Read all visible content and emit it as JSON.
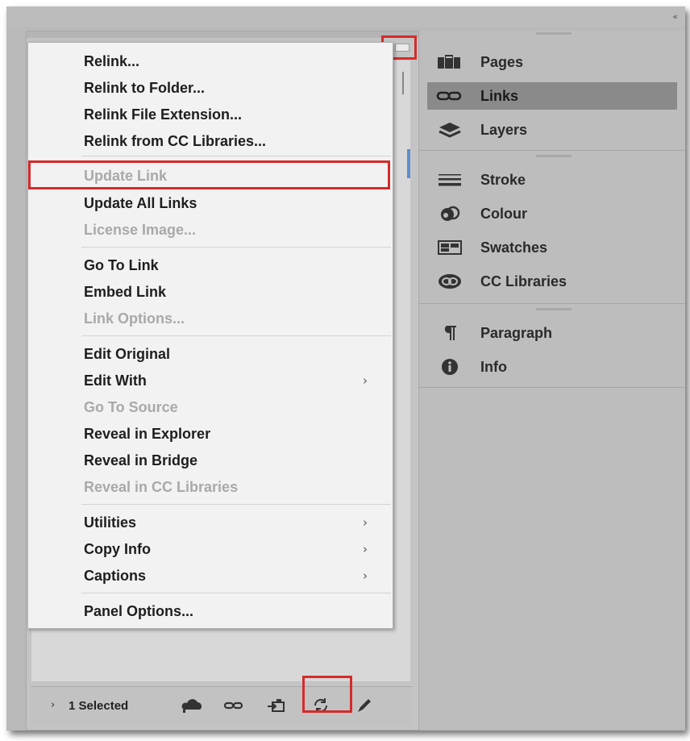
{
  "window": {
    "collapse_glyph": "«"
  },
  "links_panel": {
    "status_text": "1 Selected",
    "footer_icons": [
      "cc-libraries-icon",
      "relink-icon",
      "go-to-link-icon",
      "update-link-icon",
      "edit-original-icon"
    ]
  },
  "context_menu": {
    "items": [
      {
        "label": "Relink...",
        "enabled": true
      },
      {
        "label": "Relink to Folder...",
        "enabled": true
      },
      {
        "label": "Relink File Extension...",
        "enabled": true
      },
      {
        "label": "Relink from CC Libraries...",
        "enabled": true
      },
      {
        "label": "Update Link",
        "enabled": false
      },
      {
        "label": "Update All Links",
        "enabled": true
      },
      {
        "label": "License Image...",
        "enabled": false
      },
      {
        "label": "Go To Link",
        "enabled": true
      },
      {
        "label": "Embed Link",
        "enabled": true
      },
      {
        "label": "Link Options...",
        "enabled": false
      },
      {
        "label": "Edit Original",
        "enabled": true
      },
      {
        "label": "Edit With",
        "enabled": true,
        "submenu": true
      },
      {
        "label": "Go To Source",
        "enabled": false
      },
      {
        "label": "Reveal in Explorer",
        "enabled": true
      },
      {
        "label": "Reveal in Bridge",
        "enabled": true
      },
      {
        "label": "Reveal in CC Libraries",
        "enabled": false
      },
      {
        "label": "Utilities",
        "enabled": true,
        "submenu": true
      },
      {
        "label": "Copy Info",
        "enabled": true,
        "submenu": true
      },
      {
        "label": "Captions",
        "enabled": true,
        "submenu": true
      },
      {
        "label": "Panel Options...",
        "enabled": true
      }
    ],
    "submenu_arrow": "›"
  },
  "dock": {
    "items": [
      {
        "label": "Pages",
        "icon": "pages-icon",
        "active": false
      },
      {
        "label": "Links",
        "icon": "links-icon",
        "active": true
      },
      {
        "label": "Layers",
        "icon": "layers-icon",
        "active": false
      },
      {
        "label": "Stroke",
        "icon": "stroke-icon",
        "active": false
      },
      {
        "label": "Colour",
        "icon": "colour-icon",
        "active": false
      },
      {
        "label": "Swatches",
        "icon": "swatches-icon",
        "active": false
      },
      {
        "label": "CC Libraries",
        "icon": "cc-libraries-icon",
        "active": false
      },
      {
        "label": "Paragraph",
        "icon": "paragraph-icon",
        "active": false
      },
      {
        "label": "Info",
        "icon": "info-icon",
        "active": false
      }
    ]
  },
  "colors": {
    "highlight_red": "#d52b2b",
    "active_dock_bg": "#8a8a8a",
    "menu_bg": "#f2f2f2",
    "disabled_text": "#a9a9a9"
  }
}
